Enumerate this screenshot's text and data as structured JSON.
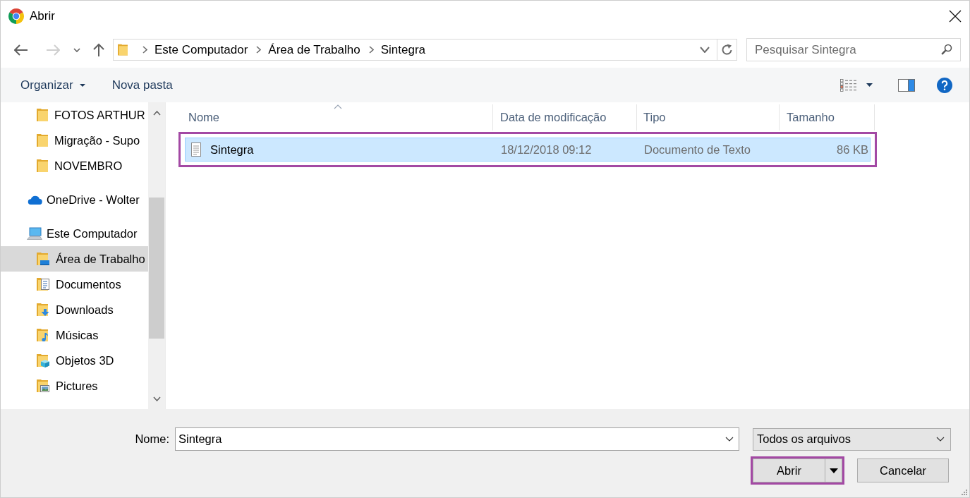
{
  "window": {
    "title": "Abrir"
  },
  "nav": {
    "buttons": [
      {
        "kind": "back",
        "disabled": false
      },
      {
        "kind": "forward",
        "disabled": true
      },
      {
        "kind": "recent",
        "disabled": false
      },
      {
        "kind": "up",
        "disabled": false
      }
    ],
    "breadcrumbs": [
      "Este Computador",
      "Área de Trabalho",
      "Sintegra"
    ]
  },
  "search": {
    "placeholder": "Pesquisar Sintegra"
  },
  "toolbar": {
    "buttons": [
      {
        "label": "Organizar",
        "dropdown": true
      },
      {
        "label": "Nova pasta",
        "dropdown": false
      }
    ]
  },
  "sidebar": {
    "items": [
      {
        "children": [
          {
            "label": "FOTOS ARTHUR",
            "kind": "folder",
            "selected": false
          },
          {
            "label": "Migração - Supo",
            "kind": "folder",
            "selected": false
          },
          {
            "label": "NOVEMBRO",
            "kind": "folder",
            "selected": false
          }
        ]
      },
      {
        "label": "OneDrive - Wolter",
        "kind": "cloud",
        "selected": false
      },
      {
        "label": "Este Computador",
        "kind": "computer",
        "selected": false,
        "children": [
          {
            "label": "Área de Trabalho",
            "kind": "desktop",
            "selected": true
          },
          {
            "label": "Documentos",
            "kind": "documents",
            "selected": false
          },
          {
            "label": "Downloads",
            "kind": "downloads",
            "selected": false
          },
          {
            "label": "Músicas",
            "kind": "music",
            "selected": false
          },
          {
            "label": "Objetos 3D",
            "kind": "objects3d",
            "selected": false
          },
          {
            "label": "Pictures",
            "kind": "pictures",
            "selected": false
          }
        ]
      }
    ]
  },
  "file_list": {
    "columns": [
      {
        "label": "Nome",
        "sorted": true
      },
      {
        "label": "Data de modificação",
        "sorted": false
      },
      {
        "label": "Tipo",
        "sorted": false
      },
      {
        "label": "Tamanho",
        "sorted": false
      }
    ],
    "rows": [
      {
        "name": "Sintegra",
        "modified": "18/12/2018 09:12",
        "type": "Documento de Texto",
        "size": "86 KB",
        "selected": true,
        "highlighted": true
      }
    ]
  },
  "footer": {
    "name_field": {
      "label": "Nome:",
      "value": "Sintegra"
    },
    "file_type": "Todos os arquivos",
    "buttons": [
      {
        "kind": "split",
        "label": "Abrir",
        "highlighted": true
      },
      {
        "kind": "plain",
        "label": "Cancelar",
        "highlighted": false
      }
    ]
  }
}
